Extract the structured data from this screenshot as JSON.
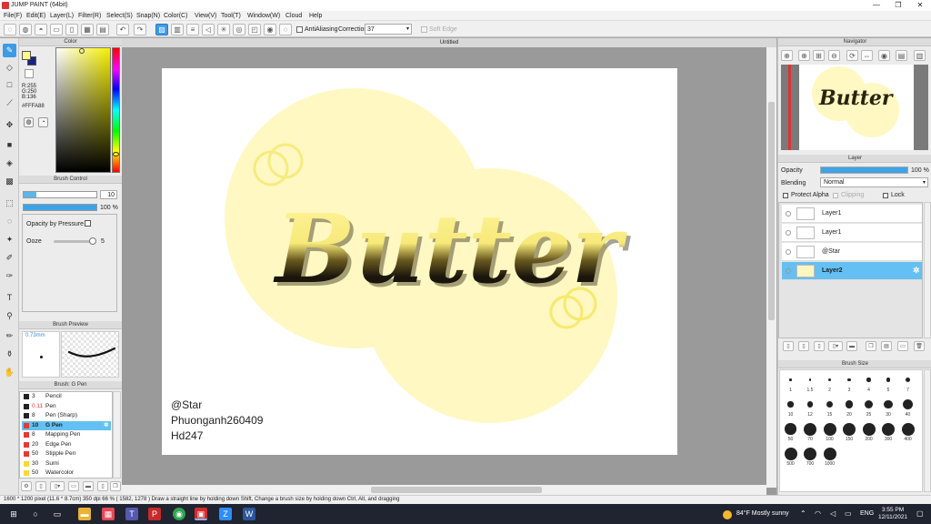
{
  "window": {
    "title": "JUMP PAINT (64bit)"
  },
  "menu": [
    "File(F)",
    "Edit(E)",
    "Layer(L)",
    "Filter(R)",
    "Select(S)",
    "Snap(N)",
    "Color(C)",
    "View(V)",
    "Tool(T)",
    "Window(W)",
    "Cloud",
    "Help"
  ],
  "toolbar": {
    "antialiasing_label": "AntiAliasing",
    "correction_label": "Correction",
    "correction_value": "37",
    "soft_edge_label": "Soft Edge"
  },
  "color_panel": {
    "title": "Color",
    "r": "R:255",
    "g": "G:250",
    "b": "B:136",
    "hex": "#FFFA88",
    "fg_color": "#FFFA88",
    "bg_color": "#1a237e"
  },
  "brush_control": {
    "title": "Brush Control",
    "size_value": "10",
    "opacity_value": "100 %",
    "opacity_fraction": 1.0,
    "opacity_by_pressure_label": "Opacity by Pressure",
    "ooze_label": "Ooze",
    "ooze_value": "5"
  },
  "brush_preview": {
    "title": "Brush Preview",
    "size": "0.73mm"
  },
  "brush_list": {
    "title": "Brush: G Pen",
    "items": [
      {
        "size": "3",
        "name": "Pencil",
        "color": "#222222"
      },
      {
        "size": "0.11",
        "name": "Pen",
        "color": "#222222"
      },
      {
        "size": "8",
        "name": "Pen (Sharp)",
        "color": "#222222"
      },
      {
        "size": "10",
        "name": "G Pen",
        "color": "#e53935"
      },
      {
        "size": "8",
        "name": "Mapping Pen",
        "color": "#e53935"
      },
      {
        "size": "20",
        "name": "Edge Pen",
        "color": "#e53935"
      },
      {
        "size": "50",
        "name": "Stipple Pen",
        "color": "#e53935"
      },
      {
        "size": "30",
        "name": "Sumi",
        "color": "#fdd835"
      },
      {
        "size": "50",
        "name": "Watercolor",
        "color": "#fdd835"
      }
    ],
    "selected_index": 3
  },
  "document": {
    "tab_title": "Untitled",
    "art_title": "Butter",
    "credit_1": "@Star",
    "credit_2": "Phuonganh260409",
    "credit_3": "Hd247"
  },
  "navigator": {
    "title": "Navigator"
  },
  "layer_panel": {
    "title": "Layer",
    "opacity_label": "Opacity",
    "opacity_value": "100 %",
    "opacity_fraction": 1.0,
    "blending_label": "Blending",
    "blending_value": "Normal",
    "protect_alpha_label": "Protect Alpha",
    "clipping_label": "Clipping",
    "lock_label": "Lock",
    "layers": [
      {
        "name": "Layer1"
      },
      {
        "name": "Layer1"
      },
      {
        "name": "@Star"
      },
      {
        "name": "Layer2"
      }
    ],
    "selected_index": 3
  },
  "brush_size_panel": {
    "title": "Brush Size",
    "sizes": [
      "1",
      "1.5",
      "2",
      "3",
      "4",
      "5",
      "7",
      "10",
      "12",
      "15",
      "20",
      "25",
      "30",
      "40",
      "50",
      "70",
      "100",
      "150",
      "200",
      "300",
      "400",
      "500",
      "700",
      "1000"
    ]
  },
  "status_bar": {
    "text": "1600 * 1200 pixel  (11.6 * 8.7cm)  350 dpi  66 %  ( 1582, 1278 )  Draw a straight line by holding down Shift, Change a brush size by holding down Ctrl, Alt, and dragging"
  },
  "taskbar": {
    "weather": "84°F  Mostly sunny",
    "lang": "ENG",
    "time": "3:55 PM",
    "date": "12/11/2021"
  }
}
